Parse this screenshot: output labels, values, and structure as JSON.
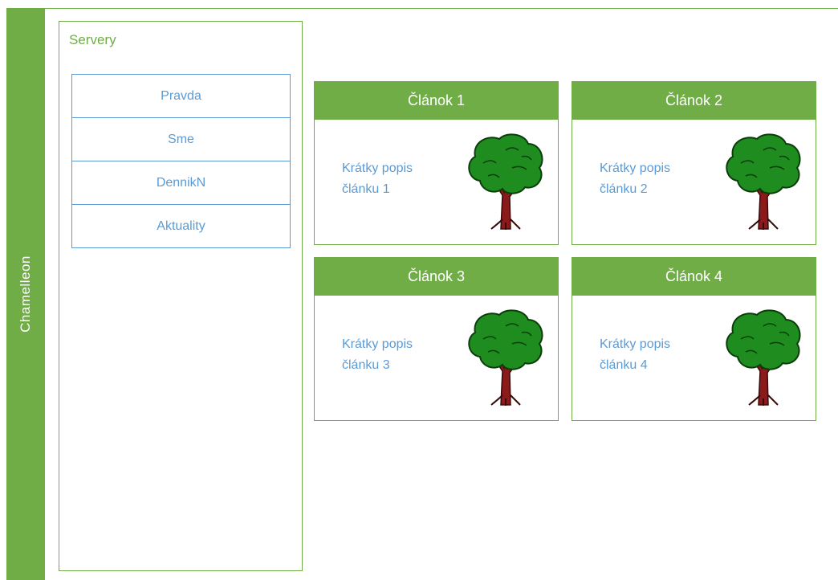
{
  "brand": {
    "label": "Chamelleon"
  },
  "servers": {
    "title": "Servery",
    "items": [
      {
        "label": "Pravda"
      },
      {
        "label": "Sme"
      },
      {
        "label": "DennikN"
      },
      {
        "label": "Aktuality"
      }
    ]
  },
  "articles": [
    {
      "title": "Článok 1",
      "desc_line1": "Krátky popis",
      "desc_line2": "článku 1",
      "icon": "tree-icon"
    },
    {
      "title": "Článok 2",
      "desc_line1": "Krátky popis",
      "desc_line2": "článku 2",
      "icon": "tree-icon"
    },
    {
      "title": "Článok 3",
      "desc_line1": "Krátky popis",
      "desc_line2": "článku 3",
      "icon": "tree-icon"
    },
    {
      "title": "Článok 4",
      "desc_line1": "Krátky popis",
      "desc_line2": "článku 4",
      "icon": "tree-icon"
    }
  ],
  "colors": {
    "accent_green": "#70ad47",
    "link_blue": "#5b9bd5",
    "tree_leaf": "#1e8c1e",
    "tree_trunk": "#8b1a1a"
  }
}
